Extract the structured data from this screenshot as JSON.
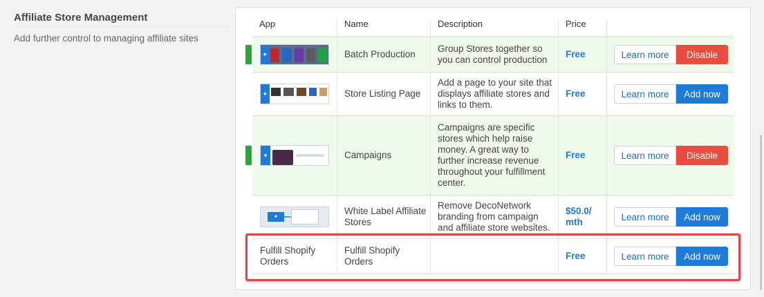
{
  "section": {
    "title": "Affiliate Store Management",
    "description": "Add further control to managing affiliate sites"
  },
  "table": {
    "headers": [
      "App",
      "Name",
      "Description",
      "Price"
    ],
    "rows": [
      {
        "app": "",
        "name": "Batch Production",
        "description": "Group Stores together so you can control production",
        "price": "Free",
        "learn": "Learn more",
        "action": "Disable",
        "enabled": true
      },
      {
        "app": "",
        "name": "Store Listing Page",
        "description": "Add a page to your site that displays affiliate stores and links to them.",
        "price": "Free",
        "learn": "Learn more",
        "action": "Add now",
        "enabled": false
      },
      {
        "app": "",
        "name": "Campaigns",
        "description": "Campaigns are specific stores which help raise money. A great way to further increase revenue throughout your fulfillment center.",
        "price": "Free",
        "learn": "Learn more",
        "action": "Disable",
        "enabled": true
      },
      {
        "app": "",
        "name": "White Label Affiliate Stores",
        "description": "Remove DecoNetwork branding from campaign and affiliate store websites.",
        "price": "$50.0/ mth",
        "learn": "Learn more",
        "action": "Add now",
        "enabled": false
      },
      {
        "app": "Fulfill Shopify Orders",
        "name": "Fulfill Shopify Orders",
        "description": "",
        "price": "Free",
        "learn": "Learn more",
        "action": "Add now",
        "enabled": false
      }
    ]
  },
  "colors": {
    "accent": "#1e7bd8",
    "danger": "#e94d3f",
    "enabled_bg": "#eefbea",
    "enabled_marker": "#2aa73a",
    "highlight": "#e0444c"
  }
}
